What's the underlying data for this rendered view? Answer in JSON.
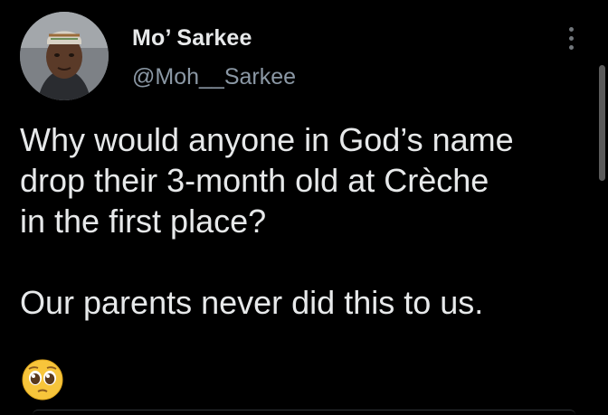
{
  "author": {
    "display_name": "Mo’ Sarkee",
    "handle": "@Moh__Sarkee"
  },
  "tweet": {
    "lines": [
      "Why would anyone in God’s name",
      "drop their 3-month old at Crèche",
      "in the first place?",
      "Our parents never did this to us."
    ],
    "emoji": "pleading-face-emoji"
  },
  "icons": {
    "menu": "more-options-icon"
  },
  "colors": {
    "background": "#000000",
    "text": "#e7e9ea",
    "secondary_text": "#8b98a5",
    "emoji_yellow": "#f7c53b"
  }
}
